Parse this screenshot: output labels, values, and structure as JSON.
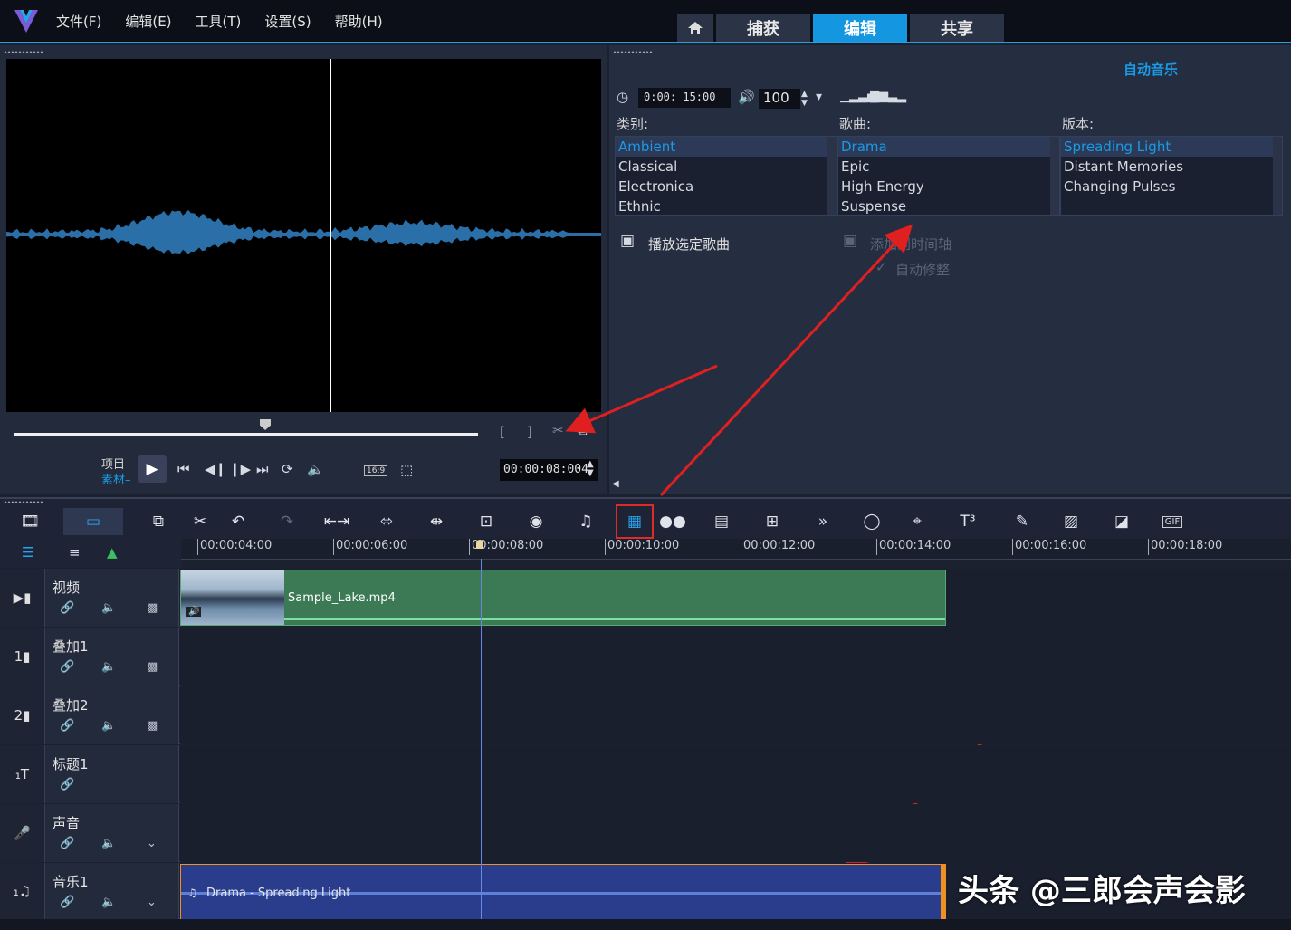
{
  "menu": [
    "文件(F)",
    "编辑(E)",
    "工具(T)",
    "设置(S)",
    "帮助(H)"
  ],
  "nav_tabs": [
    "捕获",
    "编辑",
    "共享"
  ],
  "nav_active": "编辑",
  "preview": {
    "mark_in": "[",
    "mark_out": "]",
    "project_label": "项目–",
    "clip_label": "素材–",
    "aspect": "16:9",
    "timecode": "00:00:08:004"
  },
  "auto_music": {
    "title": "自动音乐",
    "duration": "0:00: 15:00",
    "volume": "100",
    "category_label": "类别:",
    "song_label": "歌曲:",
    "version_label": "版本:",
    "categories": [
      "Ambient",
      "Classical",
      "Electronica",
      "Ethnic"
    ],
    "songs": [
      "Drama",
      "Epic",
      "High Energy",
      "Suspense"
    ],
    "versions": [
      "Spreading Light",
      "Distant Memories",
      "Changing Pulses"
    ],
    "play_selected": "播放选定歌曲",
    "add_to_timeline": "添加到时间轴",
    "auto_trim": "自动修整"
  },
  "ruler_ticks": [
    "00:00:04:00",
    "00:00:06:00",
    "00:00:08:00",
    "00:00:10:00",
    "00:00:12:00",
    "00:00:14:00",
    "00:00:16:00",
    "00:00:18:00"
  ],
  "tracks": [
    {
      "name": "视频"
    },
    {
      "name": "叠加1"
    },
    {
      "name": "叠加2"
    },
    {
      "name": "标题1"
    },
    {
      "name": "声音"
    },
    {
      "name": "音乐1"
    }
  ],
  "video_clip": "Sample_Lake.mp4",
  "music_clip": "Drama - Spreading Light",
  "watermark": "头条 @三郎会声会影"
}
